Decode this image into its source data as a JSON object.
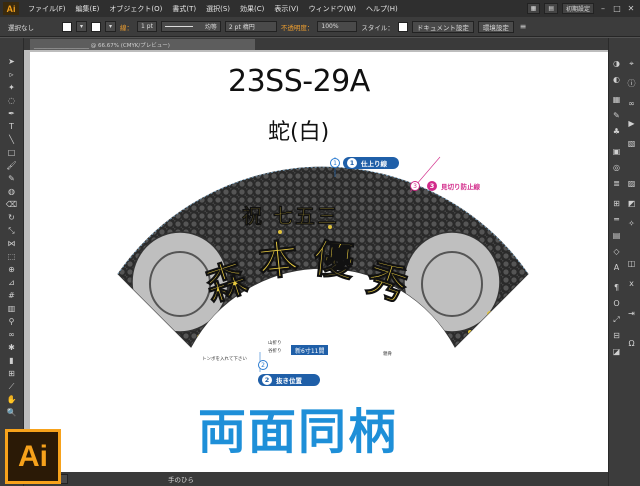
{
  "app": {
    "logo_text": "Ai",
    "menu": [
      "ファイル(F)",
      "編集(E)",
      "オブジェクト(O)",
      "書式(T)",
      "選択(S)",
      "効果(C)",
      "表示(V)",
      "ウィンドウ(W)",
      "ヘルプ(H)"
    ],
    "workspace_label": "初期設定"
  },
  "control_bar": {
    "selection_label": "選択なし",
    "stroke_label": "線：",
    "stroke_weight": "1 pt",
    "stroke_style": "均等",
    "brush_label": "2 pt 楕円",
    "opacity_label": "不透明度：",
    "opacity_value": "100%",
    "style_label": "スタイル：",
    "document_settings_button": "ドキュメント設定",
    "preferences_button": "環境設定"
  },
  "document_tab": {
    "title": "____________________ @ 66.67% (CMYK/プレビュー)"
  },
  "artwork": {
    "product_code": "23SS-29A",
    "product_subtitle": "蛇(白)",
    "footer_text": "両面同柄",
    "fan_text_top": "祝 七五三",
    "fan_name_chars": [
      "森",
      "本",
      "優",
      "秀"
    ],
    "callout_1": {
      "num": "1",
      "label": "仕上り線"
    },
    "callout_2": {
      "num": "2",
      "label": "抜き位置"
    },
    "callout_3": {
      "num": "3",
      "label": "見切り防止線"
    },
    "size_tag": "新6寸11間",
    "fold_note_1": "山折り",
    "fold_note_2": "谷折り",
    "hole_note": "トンボを入れて下さい",
    "small_side_note": "親骨"
  },
  "status_bar": {
    "tool_name": "手のひら"
  },
  "colors": {
    "accent_blue": "#1e8fd8",
    "callout_blue": "#1f5fa8",
    "callout_pink": "#d22a8a",
    "ai_orange": "#f7a21b",
    "gold": "#e0c23a"
  }
}
